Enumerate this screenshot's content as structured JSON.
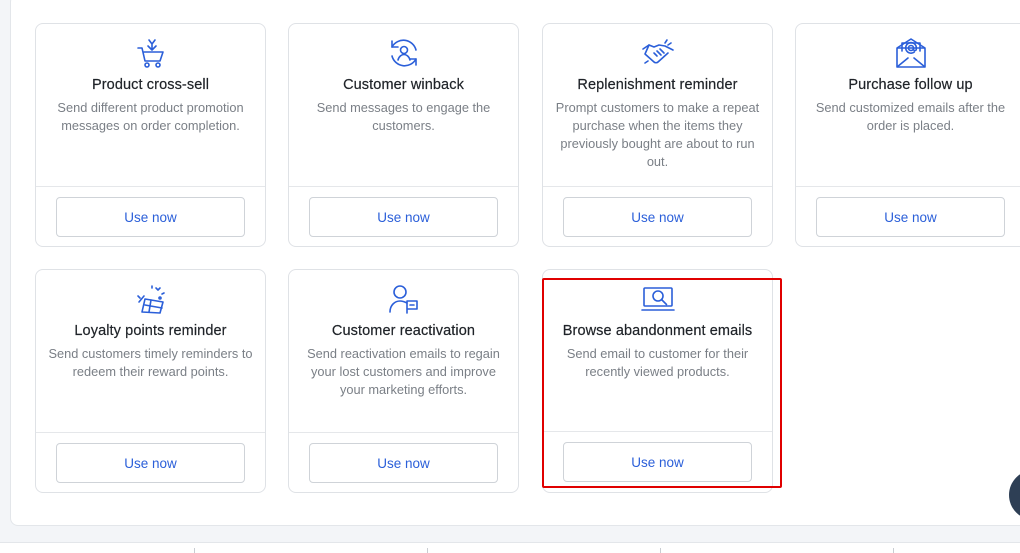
{
  "cards": [
    {
      "title": "Product cross-sell",
      "desc": "Send different product promotion messages on order completion.",
      "button": "Use now",
      "icon": "cart-icon"
    },
    {
      "title": "Customer winback",
      "desc": "Send messages to engage the customers.",
      "button": "Use now",
      "icon": "user-refresh-icon"
    },
    {
      "title": "Replenishment reminder",
      "desc": "Prompt customers to make a repeat purchase when the items they previously bought are about to run out.",
      "button": "Use now",
      "icon": "handshake-icon"
    },
    {
      "title": "Purchase follow up",
      "desc": "Send customized emails after the order is placed.",
      "button": "Use now",
      "icon": "envelope-at-icon"
    },
    {
      "title": "Loyalty points reminder",
      "desc": "Send customers timely reminders to redeem their reward points.",
      "button": "Use now",
      "icon": "gift-icon"
    },
    {
      "title": "Customer reactivation",
      "desc": "Send reactivation emails to regain your lost customers and improve your marketing efforts.",
      "button": "Use now",
      "icon": "user-flag-icon"
    },
    {
      "title": "Browse abandonment emails",
      "desc": "Send email to customer for their recently viewed products.",
      "button": "Use now",
      "icon": "laptop-search-icon"
    }
  ],
  "colors": {
    "accent": "#2b5fd9",
    "highlight": "#e00000",
    "icon": "#2b5fd9"
  }
}
